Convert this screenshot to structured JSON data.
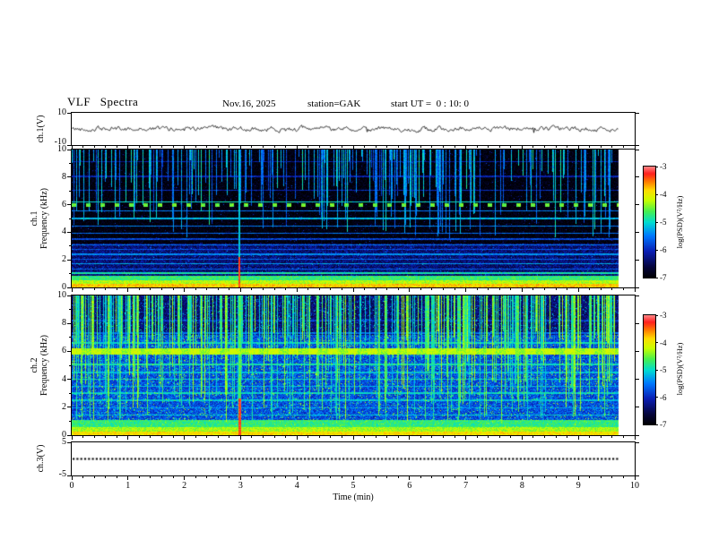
{
  "header": {
    "title": "VLF Spectra",
    "date": "Nov.16, 2025",
    "station": "station=GAK",
    "start_ut": "start UT =  0 : 10: 0"
  },
  "x_axis": {
    "label": "Time (min)",
    "min": 0,
    "max": 10,
    "tick_labels": [
      "0",
      "1",
      "2",
      "3",
      "4",
      "5",
      "6",
      "7",
      "8",
      "9",
      "10"
    ]
  },
  "panels": {
    "ch1_waveform": {
      "ylabel": "ch.1(V)",
      "ytick_top": "10",
      "ytick_bottom": "-10"
    },
    "ch1_spectrogram": {
      "ylabel_channel": "ch.1",
      "ylabel_axis": "Frequency (kHz)",
      "ytick_labels": [
        "0",
        "2",
        "4",
        "6",
        "8",
        "10"
      ]
    },
    "ch2_spectrogram": {
      "ylabel_channel": "ch.2",
      "ylabel_axis": "Frequency (kHz)",
      "ytick_labels": [
        "0",
        "2",
        "4",
        "6",
        "8",
        "10"
      ]
    },
    "ch3_waveform": {
      "ylabel": "ch.3(V)",
      "ytick_top": "5",
      "ytick_bottom": "-5"
    }
  },
  "colorbar": {
    "label": "log(PSD)(V²/Hz)",
    "min": -7,
    "max": -3,
    "tick_labels": [
      "-3",
      "-4",
      "-5",
      "-6",
      "-7"
    ]
  },
  "chart_data": [
    {
      "type": "line",
      "name": "ch.1 voltage waveform",
      "xlabel": "Time (min)",
      "xlim": [
        0,
        10
      ],
      "ylim": [
        -10,
        10
      ],
      "description": "Continuous noisy trace centered on 0 V, peak-to-peak about 3-4 V with occasional negative spikes to about -4 V; data ends at t ~ 9.7 min",
      "render": {
        "seed": 42,
        "smooth": 0.7,
        "noise_v": 2.2,
        "spike_prob": 0.012,
        "spike_v": 2.6,
        "data_end_fraction": 0.972
      }
    },
    {
      "type": "heatmap",
      "name": "ch.1 VLF spectrogram",
      "xlabel": "Time (min)",
      "ylabel": "Frequency (kHz)",
      "xlim": [
        0,
        10
      ],
      "ylim": [
        0,
        10
      ],
      "zlim": [
        -7,
        -3
      ],
      "zlabel": "log(PSD)(V²/Hz)",
      "colormap": "jet-like (black-blue-cyan-green-yellow-red)",
      "features": [
        "mostly dark (near -7) background above ~3 kHz",
        "dense vertical broadband impulses (sferics) strongest between ~4 and 10 kHz",
        "many narrow horizontal interference lines between ~1 and 9 kHz",
        "intermittent bright green dashes near 6 kHz",
        "intense band below ~1 kHz, red/orange near 0 kHz",
        "strong broadband event at t ~ 3.0 min, reaching ~-3 below ~2 kHz",
        "data ends at t ~ 9.7 min"
      ],
      "render": {
        "seed": 1234,
        "data_end_fraction": 0.972,
        "background": {
          "level": -6.9,
          "noise": 0.2,
          "boost_below": 3.2,
          "boost_level": -6.35
        },
        "speckle": {
          "prob": 0.03,
          "amp": 1.0
        },
        "h_lines": [
          [
            1.05,
            0.05,
            -4.9
          ],
          [
            1.35,
            0.04,
            -5.6
          ],
          [
            1.7,
            0.04,
            -5.3
          ],
          [
            2.05,
            0.04,
            -5.6
          ],
          [
            2.4,
            0.04,
            -5.4
          ],
          [
            2.75,
            0.04,
            -5.7
          ],
          [
            3.1,
            0.04,
            -5.5
          ],
          [
            3.5,
            0.04,
            -5.8
          ],
          [
            3.95,
            0.04,
            -5.6
          ],
          [
            4.45,
            0.05,
            -5.5
          ],
          [
            5.0,
            0.05,
            -5.2
          ],
          [
            5.55,
            0.05,
            -5.5
          ],
          [
            6.2,
            0.06,
            -5.0
          ],
          [
            7.05,
            0.04,
            -6.0
          ],
          [
            8.05,
            0.04,
            -6.1
          ],
          [
            9.1,
            0.04,
            -6.15
          ]
        ],
        "dash": {
          "freq": 5.95,
          "halfwidth": 0.13,
          "level": -4.5,
          "period": 16,
          "duty": 0.3
        },
        "streaks": {
          "density": 0.32,
          "reach_lo": 3.6,
          "reach_hi": 9.6,
          "level": -5.8
        },
        "bottom_band": [
          [
            0.28,
            -3.8
          ],
          [
            0.55,
            -4.25
          ],
          [
            0.85,
            -4.7
          ]
        ],
        "event": {
          "time": 2.97,
          "width": 2,
          "level": -5.1,
          "low_freq": 2.2,
          "low_level": -3.3
        }
      }
    },
    {
      "type": "heatmap",
      "name": "ch.2 VLF spectrogram",
      "xlabel": "Time (min)",
      "ylabel": "Frequency (kHz)",
      "xlim": [
        0,
        10
      ],
      "ylim": [
        0,
        10
      ],
      "zlim": [
        -7,
        -3
      ],
      "zlabel": "log(PSD)(V²/Hz)",
      "colormap": "jet-like (black-blue-cyan-green-yellow-red)",
      "features": [
        "diffuse cyan/green background (~-5.5 to -5) up to ~7 kHz, darker blue above",
        "continuous yellow-green band near 6 kHz",
        "dense vertical cyan sferic streaks reaching down to ~1 kHz",
        "horizontal interference lines at ~1, 1.5, 2, 2.5, 3, 3.5, 4, 4.5, 5 kHz",
        "intense band below ~1 kHz, red/orange near 0 kHz",
        "strong broadband event at t ~ 3.0 min, reaching ~-3 below ~2.5 kHz",
        "data ends at t ~ 9.7 min"
      ],
      "render": {
        "seed": 999,
        "data_end_fraction": 0.972,
        "background": {
          "level": -6.35,
          "noise": 0.3,
          "boost_below": 7.2,
          "boost_level": -5.75
        },
        "speckle": {
          "prob": 0.12,
          "amp": 1.5
        },
        "h_lines": [
          [
            1.0,
            0.07,
            -4.7
          ],
          [
            1.45,
            0.05,
            -5.1
          ],
          [
            1.95,
            0.05,
            -5.3
          ],
          [
            2.5,
            0.05,
            -5.1
          ],
          [
            3.0,
            0.05,
            -5.0
          ],
          [
            3.5,
            0.05,
            -5.2
          ],
          [
            4.0,
            0.05,
            -5.0
          ],
          [
            4.5,
            0.05,
            -5.15
          ],
          [
            5.05,
            0.06,
            -4.9
          ],
          [
            6.0,
            0.22,
            -4.35
          ],
          [
            6.6,
            0.07,
            -5.0
          ],
          [
            7.3,
            0.05,
            -5.6
          ],
          [
            8.2,
            0.04,
            -5.9
          ]
        ],
        "dash": {
          "freq": 6.0,
          "halfwidth": 0.2,
          "level": -4.2,
          "period": 22,
          "duty": 0.5
        },
        "streaks": {
          "density": 0.5,
          "reach_lo": 0.9,
          "reach_hi": 7.5,
          "level": -5.15
        },
        "bottom_band": [
          [
            0.28,
            -3.9
          ],
          [
            0.6,
            -4.3
          ],
          [
            0.95,
            -4.75
          ]
        ],
        "event": {
          "time": 2.97,
          "width": 3,
          "level": -4.7,
          "low_freq": 2.6,
          "low_level": -3.3
        }
      }
    },
    {
      "type": "line",
      "name": "ch.3 voltage waveform",
      "xlabel": "Time (min)",
      "xlim": [
        0,
        10
      ],
      "ylim": [
        -5,
        5
      ],
      "description": "Constant 0 V flat dotted trace across the full record; data ends at t ~ 9.7 min",
      "render": {
        "style": "dashed",
        "value": 0,
        "data_end_fraction": 0.972
      }
    }
  ]
}
